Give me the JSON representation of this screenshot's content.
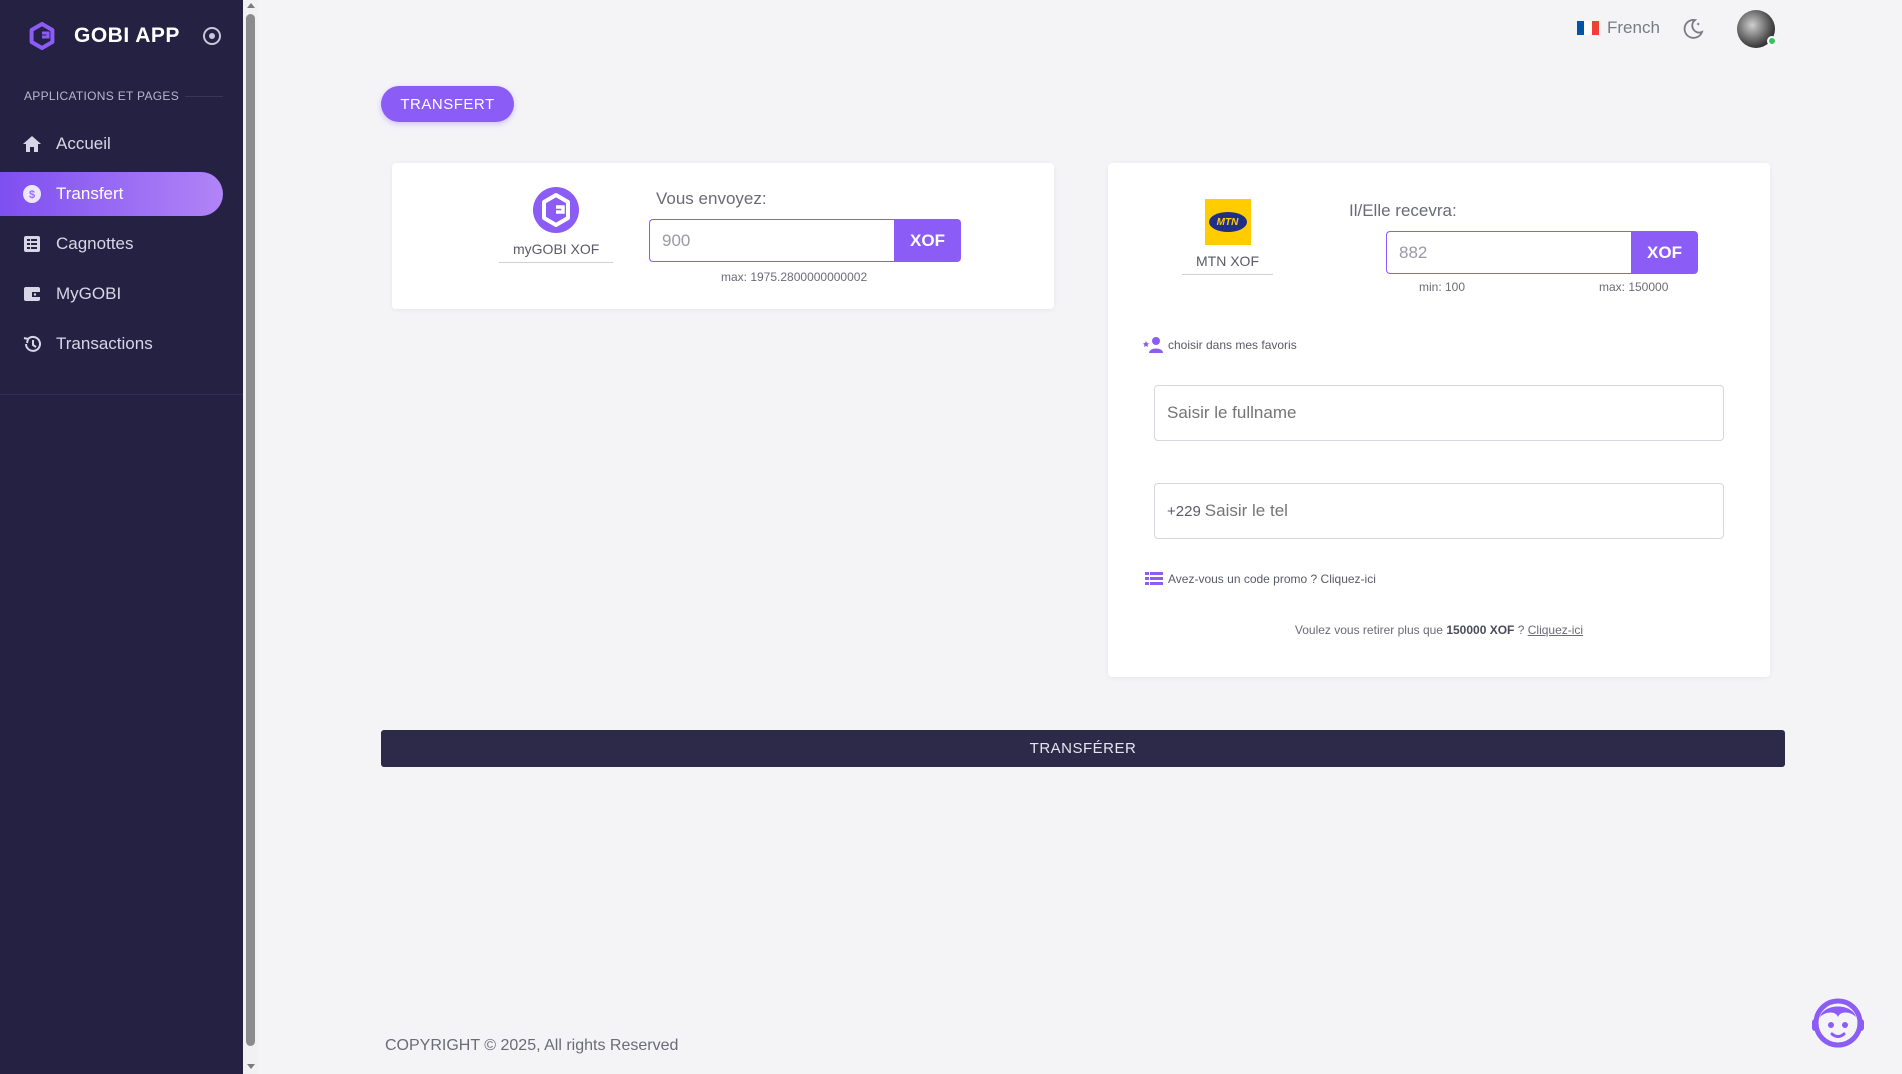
{
  "app": {
    "title": "GOBI APP"
  },
  "sidebar": {
    "section_label": "APPLICATIONS ET PAGES",
    "items": [
      {
        "label": "Accueil",
        "icon": "home-icon"
      },
      {
        "label": "Transfert",
        "icon": "dollar-circle-icon",
        "active": true
      },
      {
        "label": "Cagnottes",
        "icon": "list-box-icon"
      },
      {
        "label": "MyGOBI",
        "icon": "wallet-icon"
      },
      {
        "label": "Transactions",
        "icon": "history-icon"
      }
    ]
  },
  "topbar": {
    "language": "French",
    "language_flag_colors": [
      "#0055A4",
      "#FFFFFF",
      "#EF4135"
    ]
  },
  "page": {
    "button_label": "TRANSFERT"
  },
  "send": {
    "wallet_name": "myGOBI XOF",
    "label": "Vous envoyez:",
    "amount": "900",
    "currency": "XOF",
    "hint": "max: 1975.2800000000002"
  },
  "receive": {
    "wallet_name": "MTN XOF",
    "logo_text": "MTN",
    "label": "Il/Elle recevra:",
    "amount": "882",
    "currency": "XOF",
    "hint_min": "min: 100",
    "hint_max": "max: 150000",
    "favorites_label": "choisir dans mes favoris",
    "fullname_placeholder": "Saisir le fullname",
    "phone_prefix": "+229",
    "phone_placeholder": "Saisir le tel",
    "promo_label": "Avez-vous un code promo ? Cliquez-ici",
    "withdraw_prefix": "Voulez vous retirer plus que",
    "withdraw_amount": "150000 XOF",
    "withdraw_mid": "?",
    "withdraw_link": "Cliquez-ici"
  },
  "submit_label": "TRANSFÉRER",
  "footer": {
    "copyright": "COPYRIGHT © 2025, All rights Reserved"
  },
  "colors": {
    "accent": "#8B5CF6",
    "sidebar_bg": "#252142",
    "submit_bg": "#2D2949"
  }
}
